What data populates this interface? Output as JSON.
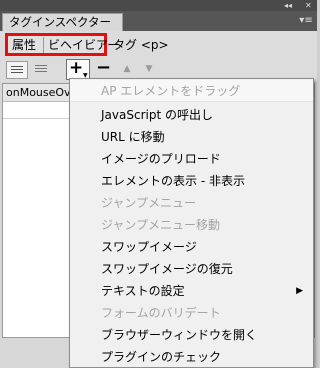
{
  "panel": {
    "title": "タグインスペクター",
    "collapse_glyph": "◂◂",
    "close_glyph": "✕",
    "menu_glyph": "▾≡"
  },
  "subtabs": [
    {
      "label": "属性"
    },
    {
      "label": "ビヘイビアー"
    },
    {
      "label": "タグ <p>"
    }
  ],
  "toolbar": {
    "add_label": "+",
    "add_dropdown": "▼",
    "remove_label": "−",
    "up_label": "▲",
    "down_label": "▼"
  },
  "behaviors": {
    "rows": [
      {
        "event": "onMouseOver"
      }
    ]
  },
  "menu": {
    "items": [
      {
        "label": "AP エレメントをドラッグ",
        "enabled": false
      },
      {
        "label": "JavaScript の呼出し",
        "enabled": true
      },
      {
        "label": "URL に移動",
        "enabled": true
      },
      {
        "label": "イメージのプリロード",
        "enabled": true
      },
      {
        "label": "エレメントの表示 - 非表示",
        "enabled": true
      },
      {
        "label": "ジャンプメニュー",
        "enabled": false
      },
      {
        "label": "ジャンプメニュー移動",
        "enabled": false
      },
      {
        "label": "スワップイメージ",
        "enabled": true
      },
      {
        "label": "スワップイメージの復元",
        "enabled": true
      },
      {
        "label": "テキストの設定",
        "enabled": true,
        "submenu_glyph": "▶"
      },
      {
        "label": "フォームのバリデート",
        "enabled": false
      },
      {
        "label": "ブラウザーウィンドウを開く",
        "enabled": true
      },
      {
        "label": "プラグインのチェック",
        "enabled": true
      }
    ]
  },
  "colors": {
    "highlight": "#e31010",
    "disabled_text": "#a4a4a4"
  }
}
